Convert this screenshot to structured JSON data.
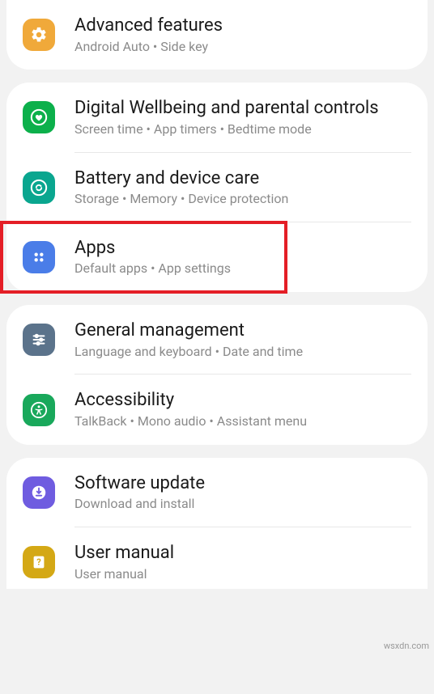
{
  "groups": [
    {
      "items": [
        {
          "id": "advanced-features",
          "title": "Advanced features",
          "subtitle": "Android Auto  •  Side key",
          "icon": "gear-plus",
          "color": "orange"
        }
      ]
    },
    {
      "items": [
        {
          "id": "digital-wellbeing",
          "title": "Digital Wellbeing and parental controls",
          "subtitle": "Screen time  •  App timers  •  Bedtime mode",
          "icon": "heart-circle",
          "color": "green-wb"
        },
        {
          "id": "battery-care",
          "title": "Battery and device care",
          "subtitle": "Storage  •  Memory  •  Device protection",
          "icon": "refresh-circle",
          "color": "teal"
        },
        {
          "id": "apps",
          "title": "Apps",
          "subtitle": "Default apps  •  App settings",
          "icon": "dots-grid",
          "color": "blue",
          "highlight": true
        }
      ]
    },
    {
      "items": [
        {
          "id": "general-management",
          "title": "General management",
          "subtitle": "Language and keyboard  •  Date and time",
          "icon": "sliders",
          "color": "bluegray"
        },
        {
          "id": "accessibility",
          "title": "Accessibility",
          "subtitle": "TalkBack  •  Mono audio  •  Assistant menu",
          "icon": "person-circle",
          "color": "green-acc"
        }
      ]
    },
    {
      "items": [
        {
          "id": "software-update",
          "title": "Software update",
          "subtitle": "Download and install",
          "icon": "download-circle",
          "color": "purple"
        },
        {
          "id": "user-manual",
          "title": "User manual",
          "subtitle": "User manual",
          "icon": "book-question",
          "color": "yellow"
        }
      ]
    }
  ],
  "watermark": "wsxdn.com"
}
